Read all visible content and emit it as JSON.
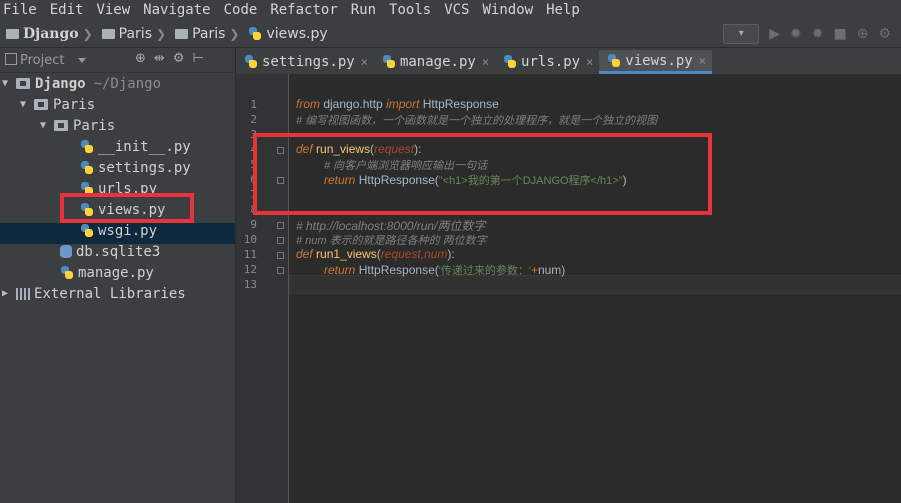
{
  "menu": [
    "File",
    "Edit",
    "View",
    "Navigate",
    "Code",
    "Refactor",
    "Run",
    "Tools",
    "VCS",
    "Window",
    "Help"
  ],
  "breadcrumbs": [
    "Django",
    "Paris",
    "Paris",
    "views.py"
  ],
  "project_panel": {
    "title": "Project",
    "icons": [
      "target-icon",
      "split-icon",
      "gear-icon",
      "collapse-icon"
    ]
  },
  "tree": [
    {
      "label": "Django",
      "suffix": "~/Django",
      "type": "folder",
      "expanded": true
    },
    {
      "label": "Paris",
      "type": "folder",
      "expanded": true
    },
    {
      "label": "Paris",
      "type": "folder",
      "expanded": true
    },
    {
      "label": "__init__.py",
      "type": "python"
    },
    {
      "label": "settings.py",
      "type": "python"
    },
    {
      "label": "urls.py",
      "type": "python"
    },
    {
      "label": "views.py",
      "type": "python",
      "selected": true
    },
    {
      "label": "wsgi.py",
      "type": "python"
    },
    {
      "label": "db.sqlite3",
      "type": "database"
    },
    {
      "label": "manage.py",
      "type": "python"
    },
    {
      "label": "External Libraries",
      "type": "library",
      "expanded": false
    }
  ],
  "tabs": [
    {
      "label": "settings.py",
      "close": "×"
    },
    {
      "label": "manage.py",
      "close": "×"
    },
    {
      "label": "urls.py",
      "close": "×"
    },
    {
      "label": "views.py",
      "close": "×",
      "active": true
    }
  ],
  "code": {
    "line_numbers": [
      "1",
      "2",
      "3",
      "4",
      "5",
      "6",
      "7",
      "8",
      "9",
      "10",
      "11",
      "12",
      "13"
    ],
    "l1": {
      "from": "from",
      "module": " django.http ",
      "import": "import",
      "name": " HttpResponse"
    },
    "l2": "# 编写视图函数，一个函数就是一个独立的处理程序，就是一个独立的视图",
    "l4": {
      "def": "def",
      "fn": " run_views",
      "open": "(",
      "param": "request",
      "close": "):"
    },
    "l5": "# 向客户端浏览器响应输出一句话",
    "l6": {
      "ret": "return",
      "call": " HttpResponse(",
      "str": "\"<h1>我的第一个DJANGO程序</h1>\"",
      "end": ")"
    },
    "l9": "# http://localhost:8000/run/两位数字",
    "l10": "# num 表示的就是路径各种的 两位数字",
    "l11": {
      "def": "def",
      "fn": " run1_views",
      "open": "(",
      "param": "request,num",
      "close": "):"
    },
    "l12": {
      "ret": "return",
      "call": " HttpResponse(",
      "str": "'传递过来的参数：'",
      "plus": "+",
      "var": "num",
      "end": ")"
    }
  },
  "colors": {
    "highlight": "#e8323c",
    "keyword": "#cc7832",
    "string": "#6a8759",
    "comment": "#808080",
    "function": "#ffc66d"
  }
}
